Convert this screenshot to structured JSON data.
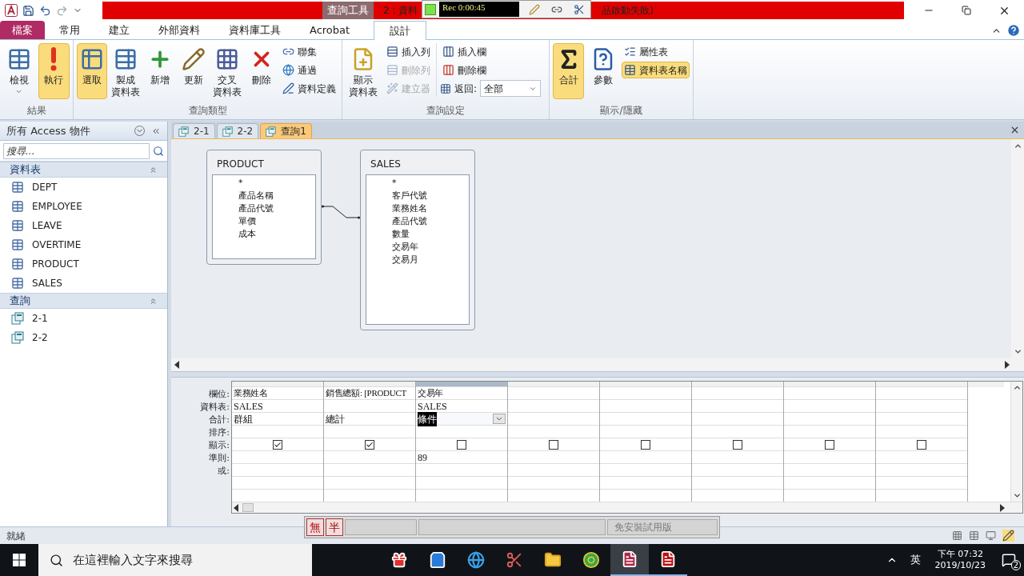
{
  "title_bar": {
    "context_tab": "查詢工具",
    "title_left": "2 : 資料",
    "title_right": "品啟動失敗)"
  },
  "recorder": {
    "time": "Rec 0:00:45"
  },
  "ribbon_tabs": [
    {
      "label": "檔案",
      "kind": "file",
      "selected": false
    },
    {
      "label": "常用",
      "kind": "tab",
      "selected": false
    },
    {
      "label": "建立",
      "kind": "tab",
      "selected": false
    },
    {
      "label": "外部資料",
      "kind": "tab",
      "selected": false
    },
    {
      "label": "資料庫工具",
      "kind": "tab",
      "selected": false
    },
    {
      "label": "Acrobat",
      "kind": "tab",
      "selected": false
    },
    {
      "label": "設計",
      "kind": "tab",
      "selected": true
    }
  ],
  "ribbon_groups": [
    {
      "label": "結果",
      "large": [
        {
          "label": [
            "檢視"
          ],
          "dropdown": true,
          "selected": false
        },
        {
          "label": [
            "執行"
          ],
          "dropdown": false,
          "selected": true
        }
      ]
    },
    {
      "label": "查詢類型",
      "large": [
        {
          "label": [
            "選取"
          ],
          "selected": true
        },
        {
          "label": [
            "製成",
            "資料表"
          ],
          "selected": false
        },
        {
          "label": [
            "新增"
          ],
          "selected": false
        },
        {
          "label": [
            "更新"
          ],
          "selected": false
        },
        {
          "label": [
            "交叉",
            "資料表"
          ],
          "selected": false
        },
        {
          "label": [
            "刪除"
          ],
          "selected": false
        }
      ],
      "small": [
        {
          "label": "聯集",
          "disabled": false
        },
        {
          "label": "通過",
          "disabled": false
        },
        {
          "label": "資料定義",
          "disabled": false
        }
      ]
    },
    {
      "label": "查詢設定",
      "large": [
        {
          "label": [
            "顯示",
            "資料表"
          ],
          "selected": false
        }
      ],
      "small": [
        {
          "label": "插入列",
          "disabled": false
        },
        {
          "label": "刪除列",
          "disabled": true
        },
        {
          "label": "建立器",
          "disabled": true
        },
        {
          "label": "插入欄",
          "disabled": false
        },
        {
          "label": "刪除欄",
          "disabled": false
        }
      ],
      "return_label": "返回:",
      "return_value": "全部"
    },
    {
      "label": "顯示/隱藏",
      "large": [
        {
          "label": [
            "合計"
          ],
          "selected": true
        },
        {
          "label": [
            "參數"
          ],
          "selected": false
        }
      ],
      "small": [
        {
          "label": "屬性表",
          "selected": false
        },
        {
          "label": "資料表名稱",
          "selected": true
        }
      ]
    }
  ],
  "nav_pane": {
    "title": "所有 Access 物件",
    "search": {
      "placeholder": "搜尋..."
    },
    "sections": [
      {
        "title": "資料表",
        "kind": "table",
        "items": [
          "DEPT",
          "EMPLOYEE",
          "LEAVE",
          "OVERTIME",
          "PRODUCT",
          "SALES"
        ]
      },
      {
        "title": "查詢",
        "kind": "query",
        "items": [
          "2-1",
          "2-2"
        ]
      }
    ]
  },
  "doc_tabs": [
    {
      "label": "2-1",
      "selected": false
    },
    {
      "label": "2-2",
      "selected": false
    },
    {
      "label": "查詢1",
      "selected": true
    }
  ],
  "tables": [
    {
      "name": "PRODUCT",
      "fields": [
        "*",
        "產品名稱",
        "產品代號",
        "單價",
        "成本"
      ]
    },
    {
      "name": "SALES",
      "fields": [
        "*",
        "客戶代號",
        "業務姓名",
        "產品代號",
        "數量",
        "交易年",
        "交易月"
      ]
    }
  ],
  "grid": {
    "row_labels": [
      "欄位:",
      "資料表:",
      "合計:",
      "排序:",
      "顯示:",
      "準則:",
      "或:"
    ],
    "columns": [
      {
        "field": "業務姓名",
        "table": "SALES",
        "total": "群組",
        "show": true,
        "selected": false
      },
      {
        "field": "銷售總額: [PRODUCT",
        "total": "總計",
        "show": true,
        "selected": false
      },
      {
        "field": "交易年",
        "table": "SALES",
        "total": "條件",
        "show": false,
        "criteria": "89",
        "selected": true
      },
      {
        "show": false,
        "selected": false
      },
      {
        "show": false,
        "selected": false
      },
      {
        "show": false,
        "selected": false
      },
      {
        "show": false,
        "selected": false
      },
      {
        "show": false,
        "selected": false
      }
    ]
  },
  "ime_bar": {
    "mode": "無",
    "width": "半",
    "label": "免安裝試用版"
  },
  "status_bar": {
    "text": "就緒"
  },
  "taskbar": {
    "search_placeholder": "在這裡輸入文字來搜尋",
    "ime": "英",
    "time": "下午 07:32",
    "date": "2019/10/23",
    "notifications": "2"
  }
}
